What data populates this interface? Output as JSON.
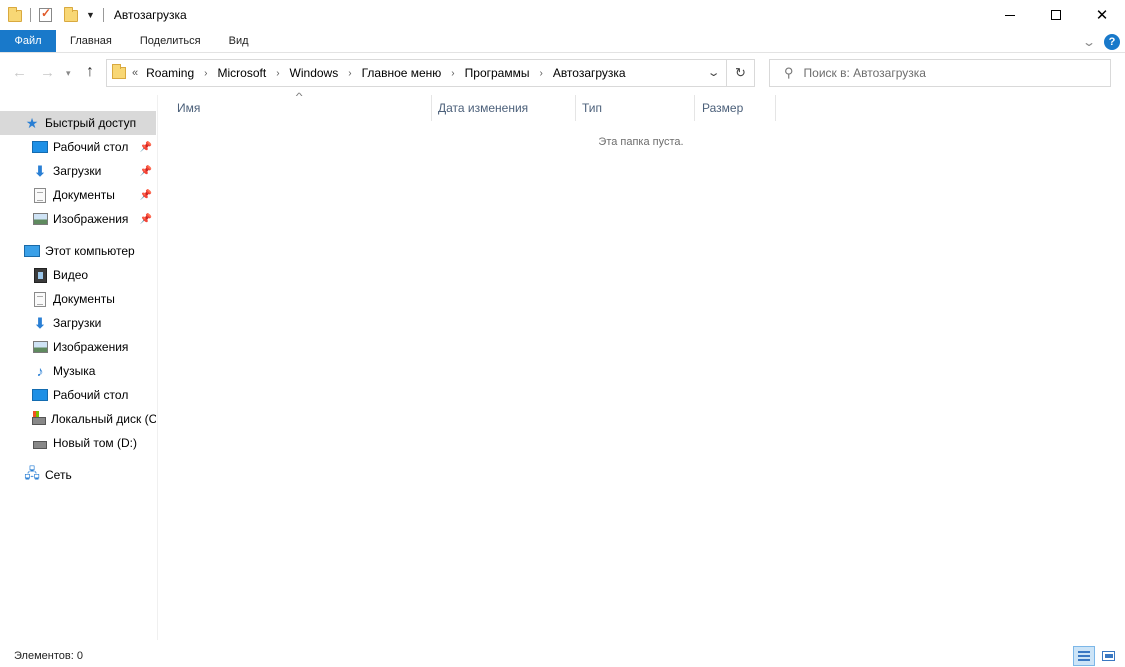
{
  "window": {
    "title": "Автозагрузка",
    "close_glyph": "✕"
  },
  "ribbon": {
    "tabs": [
      {
        "label": "Файл",
        "active": true
      },
      {
        "label": "Главная"
      },
      {
        "label": "Поделиться"
      },
      {
        "label": "Вид"
      }
    ],
    "help_label": "?"
  },
  "address": {
    "overflow": "«",
    "crumbs": [
      "Roaming",
      "Microsoft",
      "Windows",
      "Главное меню",
      "Программы",
      "Автозагрузка"
    ],
    "separator": "›"
  },
  "search": {
    "placeholder": "Поиск в: Автозагрузка"
  },
  "sidebar": {
    "quick_access": {
      "label": "Быстрый доступ",
      "icon": "star-icon"
    },
    "quick_items": [
      {
        "label": "Рабочий стол",
        "icon": "desktop-icon",
        "pinned": true
      },
      {
        "label": "Загрузки",
        "icon": "download-icon",
        "pinned": true
      },
      {
        "label": "Документы",
        "icon": "document-icon",
        "pinned": true
      },
      {
        "label": "Изображения",
        "icon": "image-icon",
        "pinned": true
      }
    ],
    "this_pc": {
      "label": "Этот компьютер",
      "icon": "computer-icon"
    },
    "pc_items": [
      {
        "label": "Видео",
        "icon": "video-icon"
      },
      {
        "label": "Документы",
        "icon": "document-icon"
      },
      {
        "label": "Загрузки",
        "icon": "download-icon"
      },
      {
        "label": "Изображения",
        "icon": "image-icon"
      },
      {
        "label": "Музыка",
        "icon": "music-icon"
      },
      {
        "label": "Рабочий стол",
        "icon": "desktop-icon"
      },
      {
        "label": "Локальный диск (C",
        "icon": "disk-c-icon"
      },
      {
        "label": "Новый том (D:)",
        "icon": "disk-icon"
      }
    ],
    "network": {
      "label": "Сеть",
      "icon": "network-icon"
    }
  },
  "columns": [
    {
      "label": "Имя",
      "sorted": "asc"
    },
    {
      "label": "Дата изменения"
    },
    {
      "label": "Тип"
    },
    {
      "label": "Размер"
    }
  ],
  "empty_message": "Эта папка пуста.",
  "status": {
    "items_count": "Элементов: 0"
  }
}
